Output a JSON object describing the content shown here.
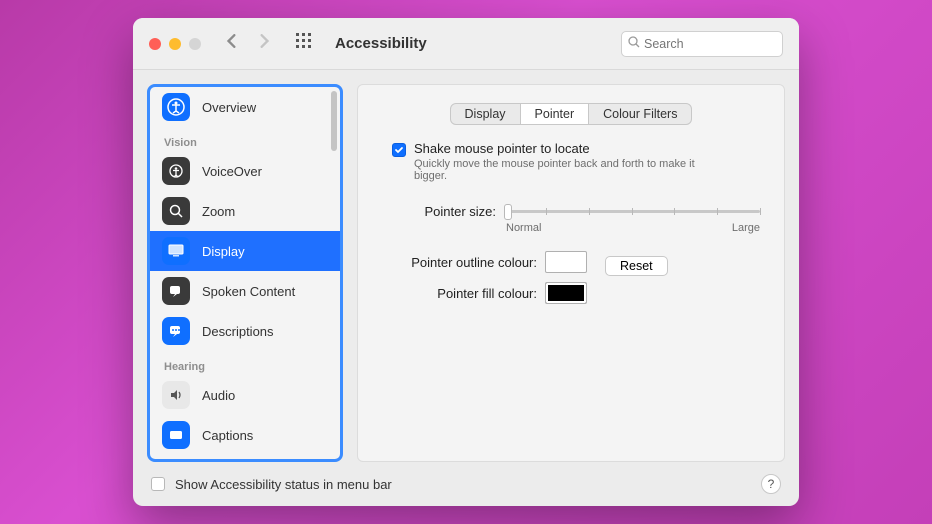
{
  "header": {
    "title": "Accessibility",
    "search_placeholder": "Search"
  },
  "sidebar": {
    "items": [
      {
        "label": "Overview"
      }
    ],
    "vision_header": "Vision",
    "vision_items": [
      {
        "label": "VoiceOver"
      },
      {
        "label": "Zoom"
      },
      {
        "label": "Display"
      },
      {
        "label": "Spoken Content"
      },
      {
        "label": "Descriptions"
      }
    ],
    "hearing_header": "Hearing",
    "hearing_items": [
      {
        "label": "Audio"
      },
      {
        "label": "Captions"
      }
    ]
  },
  "tabs": {
    "display": "Display",
    "pointer": "Pointer",
    "colour_filters": "Colour Filters"
  },
  "panel": {
    "shake_label": "Shake mouse pointer to locate",
    "shake_hint": "Quickly move the mouse pointer back and forth to make it bigger.",
    "pointer_size_label": "Pointer size:",
    "normal": "Normal",
    "large": "Large",
    "outline_label": "Pointer outline colour:",
    "fill_label": "Pointer fill colour:",
    "reset": "Reset",
    "outline_colour": "#ffffff",
    "fill_colour": "#000000"
  },
  "footer": {
    "show_status_label": "Show Accessibility status in menu bar",
    "help": "?"
  }
}
